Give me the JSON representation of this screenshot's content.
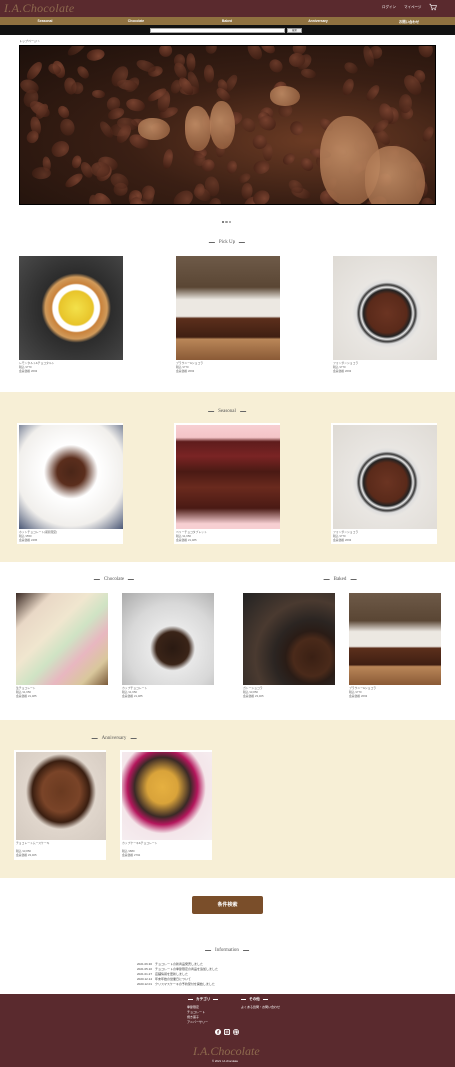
{
  "header": {
    "logo": "I.A.Chocolate",
    "links": [
      "ログイン",
      "マイページ"
    ],
    "cart_icon": "cart-icon"
  },
  "nav": {
    "items": [
      "Seasonal",
      "Chocolate",
      "Baked",
      "Anniversary",
      "お問い合わせ"
    ]
  },
  "search": {
    "placeholder": "",
    "button_label": "検索"
  },
  "breadcrumb": "トップページ > ",
  "pickup": {
    "title": "Pick Up",
    "items": [
      {
        "name": "レモンタルト&チョコタルト",
        "price1": "税込 ¥770",
        "price2": "会員価格 ¥693"
      },
      {
        "name": "ブラウニー&ショコラ",
        "price1": "税込 ¥770",
        "price2": "会員価格 ¥693"
      },
      {
        "name": "フォンダンショコラ",
        "price1": "税込 ¥770",
        "price2": "会員価格 ¥693"
      }
    ]
  },
  "seasonal": {
    "title": "Seasonal",
    "items": [
      {
        "name": "ホットチョコレート(期間限定)",
        "price1": "税込 ¥550",
        "price2": "会員価格 ¥495"
      },
      {
        "name": "ベリーチョコタブレット",
        "price1": "税込 ¥1,650",
        "price2": "会員価格 ¥1,485"
      },
      {
        "name": "フォンダンショコラ",
        "price1": "税込 ¥770",
        "price2": "会員価格 ¥693"
      }
    ]
  },
  "chocolate": {
    "title": "Chocolate",
    "items": [
      {
        "name": "生チョコレート",
        "price1": "税込 ¥1,650",
        "price2": "会員価格 ¥1,485"
      },
      {
        "name": "カップチョコレート",
        "price1": "税込 ¥1,650",
        "price2": "会員価格 ¥1,485"
      }
    ]
  },
  "baked": {
    "title": "Baked",
    "items": [
      {
        "name": "ガトーショコラ",
        "price1": "税込 ¥3,850",
        "price2": "会員価格 ¥3,465"
      },
      {
        "name": "ブラウニー&ショコラ",
        "price1": "税込 ¥770",
        "price2": "会員価格 ¥693"
      }
    ]
  },
  "anniversary": {
    "title": "Anniversary",
    "items": [
      {
        "name": "チョコレートムースケーキ",
        "price1": "税込 ¥3,850",
        "price2": "会員価格 ¥3,465"
      },
      {
        "name": "カップケーキ&チョコレート",
        "price1": "税込 ¥880",
        "price2": "会員価格 ¥792"
      }
    ]
  },
  "condition_search_label": "条件検索",
  "information": {
    "title": "Information",
    "entries": [
      "2021.06.30　チョコレートの新商品発売しました",
      "2021.05.10　チョコレートの季節限定の商品を追加しました",
      "2021.01.27　店舗情報を更新しました",
      "2020.12.14　年末年始の営業日について",
      "2020.12.01　クリスマスケーキの予約受付を開始しました"
    ]
  },
  "footer": {
    "category_head": "カテゴリ",
    "category_items": [
      "季節限定",
      "チョコレート",
      "焼き菓子",
      "アニバーサリー"
    ],
    "other_head": "その他",
    "other_items": [
      "よくある質問・お問い合わせ"
    ],
    "social_icons": [
      "facebook-icon",
      "instagram-icon",
      "pinterest-icon"
    ],
    "logo": "I.A.Chocolate",
    "copyright": "© 2021 I.A.chocolate"
  },
  "colors": {
    "header_bg": "#5a2a2e",
    "nav_bg": "#8f7140",
    "band_bg": "#f7efd6",
    "button_bg": "#7a4e2a"
  }
}
